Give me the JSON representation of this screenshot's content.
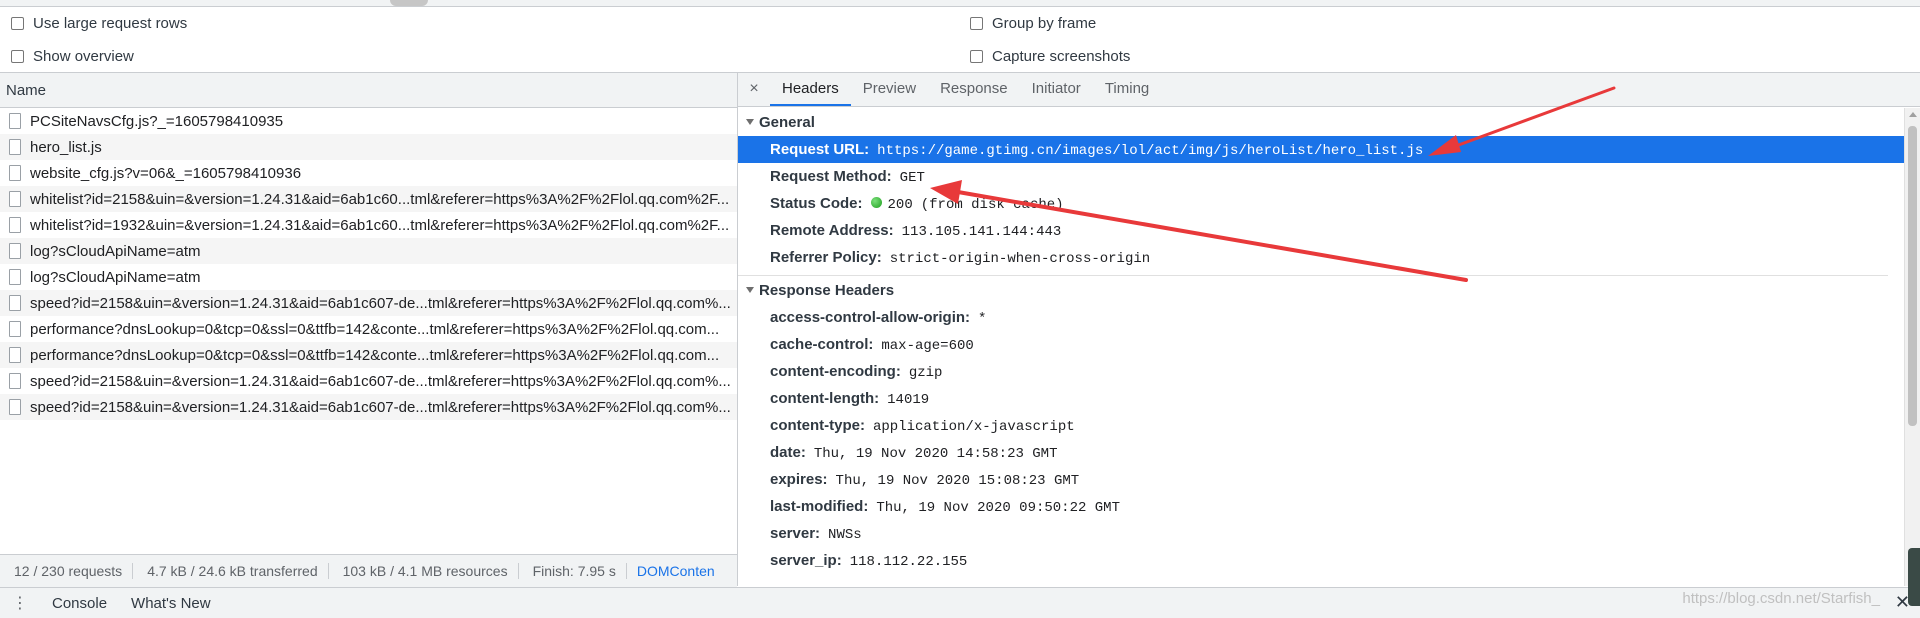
{
  "settings": {
    "large_rows": "Use large request rows",
    "show_overview": "Show overview",
    "group_by_frame": "Group by frame",
    "capture_screenshots": "Capture screenshots"
  },
  "requests": {
    "column": "Name",
    "items": [
      "PCSiteNavsCfg.js?_=1605798410935",
      "hero_list.js",
      "website_cfg.js?v=06&_=1605798410936",
      "whitelist?id=2158&uin=&version=1.24.31&aid=6ab1c60...tml&referer=https%3A%2F%2Flol.qq.com%2F...",
      "whitelist?id=1932&uin=&version=1.24.31&aid=6ab1c60...tml&referer=https%3A%2F%2Flol.qq.com%2F...",
      "log?sCloudApiName=atm",
      "log?sCloudApiName=atm",
      "speed?id=2158&uin=&version=1.24.31&aid=6ab1c607-de...tml&referer=https%3A%2F%2Flol.qq.com%...",
      "performance?dnsLookup=0&tcp=0&ssl=0&ttfb=142&conte...tml&referer=https%3A%2F%2Flol.qq.com...",
      "performance?dnsLookup=0&tcp=0&ssl=0&ttfb=142&conte...tml&referer=https%3A%2F%2Flol.qq.com...",
      "speed?id=2158&uin=&version=1.24.31&aid=6ab1c607-de...tml&referer=https%3A%2F%2Flol.qq.com%...",
      "speed?id=2158&uin=&version=1.24.31&aid=6ab1c607-de...tml&referer=https%3A%2F%2Flol.qq.com%..."
    ]
  },
  "status": {
    "requests": "12 / 230 requests",
    "transferred": "4.7 kB / 24.6 kB transferred",
    "resources": "103 kB / 4.1 MB resources",
    "finish": "Finish: 7.95 s",
    "domcontent": "DOMConten"
  },
  "tabs": [
    "Headers",
    "Preview",
    "Response",
    "Initiator",
    "Timing"
  ],
  "close_glyph": "×",
  "general": {
    "title": "General",
    "rows": [
      {
        "k": "Request URL:",
        "v": "https://game.gtimg.cn/images/lol/act/img/js/heroList/hero_list.js"
      },
      {
        "k": "Request Method:",
        "v": "GET"
      },
      {
        "k": "Status Code:",
        "v": "200",
        "extra": "(from disk cache)"
      },
      {
        "k": "Remote Address:",
        "v": "113.105.141.144:443"
      },
      {
        "k": "Referrer Policy:",
        "v": "strict-origin-when-cross-origin"
      }
    ]
  },
  "response_headers": {
    "title": "Response Headers",
    "rows": [
      {
        "k": "access-control-allow-origin:",
        "v": "*"
      },
      {
        "k": "cache-control:",
        "v": "max-age=600"
      },
      {
        "k": "content-encoding:",
        "v": "gzip"
      },
      {
        "k": "content-length:",
        "v": "14019"
      },
      {
        "k": "content-type:",
        "v": "application/x-javascript"
      },
      {
        "k": "date:",
        "v": "Thu, 19 Nov 2020 14:58:23 GMT"
      },
      {
        "k": "expires:",
        "v": "Thu, 19 Nov 2020 15:08:23 GMT"
      },
      {
        "k": "last-modified:",
        "v": "Thu, 19 Nov 2020 09:50:22 GMT"
      },
      {
        "k": "server:",
        "v": "NWSs"
      },
      {
        "k": "server_ip:",
        "v": "118.112.22.155"
      }
    ]
  },
  "drawer": {
    "menu": "⋮",
    "console": "Console",
    "whats_new": "What's New",
    "close": "✕"
  },
  "watermark": "https://blog.csdn.net/Starfish_",
  "colors": {
    "selection": "#1a73e8",
    "arrow": "#e8393a"
  }
}
